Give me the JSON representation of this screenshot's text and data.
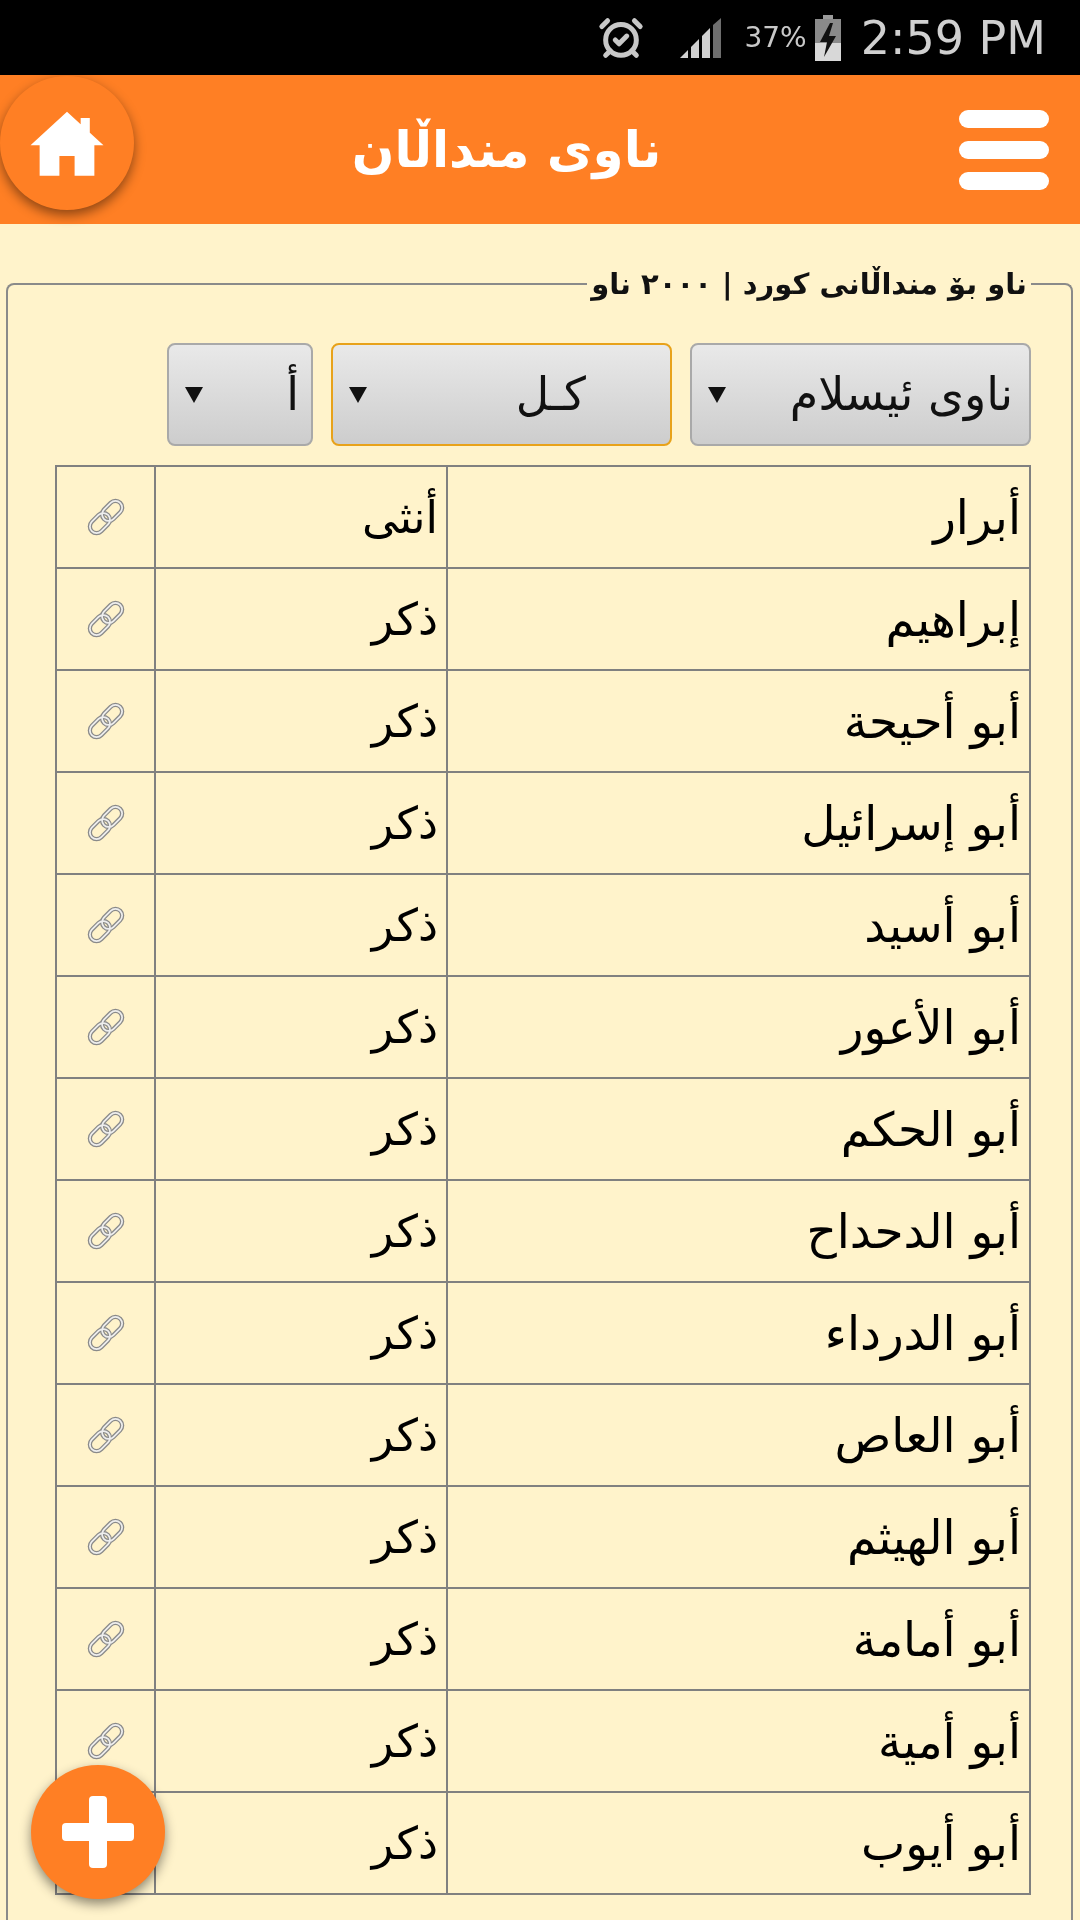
{
  "status_bar": {
    "battery": "37%",
    "time": "2:59 PM"
  },
  "header": {
    "title": "ناوی منداڵان"
  },
  "panel": {
    "legend": "ناو بۆ منداڵانی کورد | ٢٠٠٠ ناو",
    "filters": [
      {
        "value": "ناوی ئیسلام",
        "focused": false
      },
      {
        "value": "كـل",
        "focused": true
      },
      {
        "value": "أ",
        "focused": false
      }
    ]
  },
  "table": {
    "rows": [
      {
        "name": "أبرار",
        "gender": "أنثى"
      },
      {
        "name": "إبراهيم",
        "gender": "ذكر"
      },
      {
        "name": "أبو أحيحة",
        "gender": "ذكر"
      },
      {
        "name": "أبو إسرائيل",
        "gender": "ذكر"
      },
      {
        "name": "أبو أسيد",
        "gender": "ذكر"
      },
      {
        "name": "أبو الأعور",
        "gender": "ذكر"
      },
      {
        "name": "أبو الحكم",
        "gender": "ذكر"
      },
      {
        "name": "أبو الدحداح",
        "gender": "ذكر"
      },
      {
        "name": "أبو الدرداء",
        "gender": "ذكر"
      },
      {
        "name": "أبو العاص",
        "gender": "ذكر"
      },
      {
        "name": "أبو الهيثم",
        "gender": "ذكر"
      },
      {
        "name": "أبو أمامة",
        "gender": "ذكر"
      },
      {
        "name": "أبو أمية",
        "gender": "ذكر"
      },
      {
        "name": "أبو أيوب",
        "gender": "ذكر"
      }
    ]
  }
}
